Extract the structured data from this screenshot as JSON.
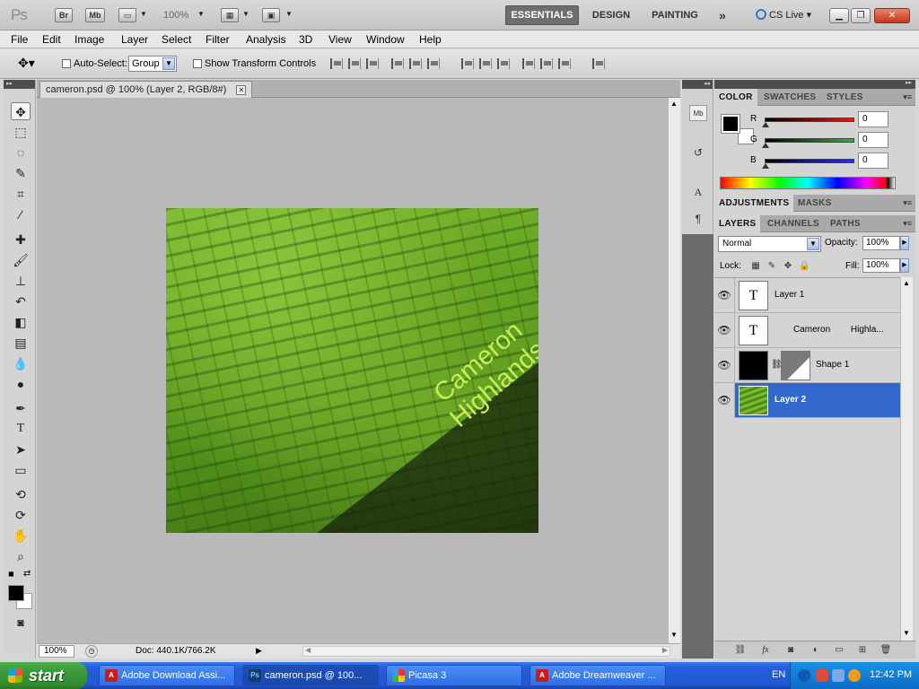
{
  "app": {
    "logo": "Ps",
    "bridge_label": "Br",
    "minibridge_label": "Mb",
    "zoom": "100%",
    "workspaces": [
      "ESSENTIALS",
      "DESIGN",
      "PAINTING"
    ],
    "more_workspaces": "»",
    "cs_live": "CS Live"
  },
  "menu": [
    "File",
    "Edit",
    "Image",
    "Layer",
    "Select",
    "Filter",
    "Analysis",
    "3D",
    "View",
    "Window",
    "Help"
  ],
  "options": {
    "auto_select_label": "Auto-Select:",
    "auto_select_value": "Group",
    "transform_label": "Show Transform Controls"
  },
  "document": {
    "tab_title": "cameron.psd @ 100% (Layer 2, RGB/8#)",
    "zoom": "100%",
    "doc_info": "Doc: 440.1K/766.2K",
    "image_text": [
      "Cameron",
      "Highlands"
    ]
  },
  "color_panel": {
    "tabs": [
      "COLOR",
      "SWATCHES",
      "STYLES"
    ],
    "channels": [
      {
        "label": "R",
        "value": "0",
        "color": "#d11d1d"
      },
      {
        "label": "G",
        "value": "0",
        "color": "#1fae1f"
      },
      {
        "label": "B",
        "value": "0",
        "color": "#1e22d8"
      }
    ]
  },
  "adjustments_panel": {
    "tabs": [
      "ADJUSTMENTS",
      "MASKS"
    ]
  },
  "layers_panel": {
    "tabs": [
      "LAYERS",
      "CHANNELS",
      "PATHS"
    ],
    "blend_mode": "Normal",
    "opacity_label": "Opacity:",
    "opacity": "100%",
    "lock_label": "Lock:",
    "fill_label": "Fill:",
    "fill": "100%",
    "layers": [
      {
        "name": "Layer 1",
        "kind": "text",
        "thumb": "T"
      },
      {
        "name": "Cameron Highla...",
        "kind": "text",
        "thumb": "T"
      },
      {
        "name": "Shape 1",
        "kind": "shape",
        "thumb": ""
      },
      {
        "name": "Layer 2",
        "kind": "image",
        "thumb": "",
        "selected": true
      }
    ]
  },
  "taskbar": {
    "start": "start",
    "tasks": [
      {
        "label": "Adobe Download Assi...",
        "icon": "adobe-icon"
      },
      {
        "label": "cameron.psd @ 100...",
        "icon": "photoshop-icon",
        "active": true
      },
      {
        "label": "Picasa 3",
        "icon": "picasa-icon"
      },
      {
        "label": "Adobe Dreamweaver ...",
        "icon": "dreamweaver-icon"
      }
    ],
    "lang": "EN",
    "time": "12:42 PM"
  }
}
